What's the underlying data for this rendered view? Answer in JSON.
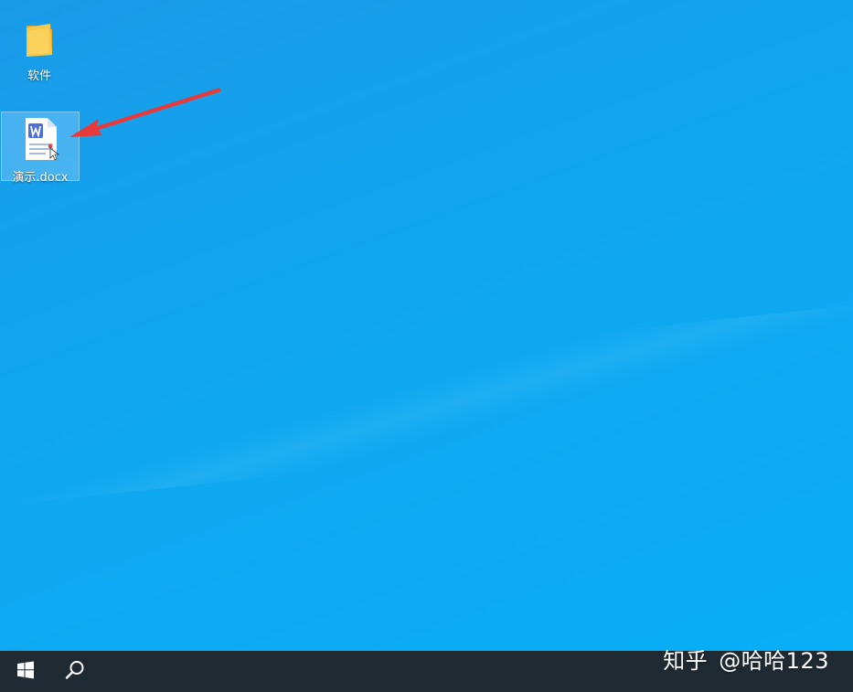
{
  "desktop": {
    "icons": [
      {
        "label": "软件",
        "icon": "folder-icon"
      },
      {
        "label": "演示.docx",
        "icon": "word-document-icon"
      }
    ],
    "annotation_color": "#e8393b"
  },
  "taskbar": {
    "start_icon": "windows-start-icon",
    "search_icon": "search-icon"
  },
  "watermark": {
    "site": "知乎",
    "author": "@哈哈123"
  },
  "colors": {
    "desktop_background": "#0ea8f2",
    "taskbar_background": "#1f2a33",
    "folder_yellow": "#f5c84a",
    "word_blue": "#4f6fd8"
  }
}
